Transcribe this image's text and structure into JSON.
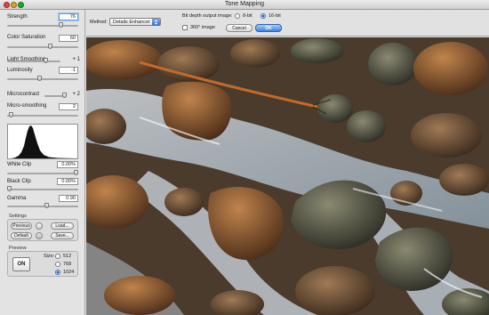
{
  "window": {
    "title": "Tone Mapping"
  },
  "sidebar": {
    "strength": {
      "label": "Strength",
      "value": "76",
      "level": 0.76
    },
    "color_saturation": {
      "label": "Color Saturation",
      "value": "60",
      "level": 0.6
    },
    "light_smoothing": {
      "label": "Light Smoothing",
      "value": "+ 1",
      "level": 0.72
    },
    "luminosity": {
      "label": "Luminosity",
      "value": "-1",
      "level": 0.45
    },
    "microcontrast": {
      "label": "Microcontrast",
      "value": "+ 2",
      "level": 1.0
    },
    "micro_smoothing": {
      "label": "Micro-smoothing",
      "value": "2",
      "level": 0.05
    },
    "white_clip": {
      "label": "White Clip",
      "value": "0.00%",
      "level": 1.0
    },
    "black_clip": {
      "label": "Black Clip",
      "value": "0.00%",
      "level": 0.0
    },
    "gamma": {
      "label": "Gamma",
      "value": "0.90",
      "level": 0.55
    },
    "settings": {
      "title": "Settings",
      "previous_label": "Previous",
      "load_label": "Load...",
      "default_label": "Default",
      "save_label": "Save..."
    },
    "preview": {
      "title": "Preview",
      "on_label": "ON",
      "size_label": "Size:",
      "sizes": [
        "512",
        "768",
        "1024"
      ],
      "selected_size": "1024"
    }
  },
  "toolbar": {
    "method_label": "Method:",
    "method_value": "Details Enhancer",
    "bit_depth_label": "Bit depth output image:",
    "bit_options": [
      "8-bit",
      "16-bit"
    ],
    "selected_bit": "16-bit",
    "image360_label": "360° image",
    "cancel_label": "Cancel",
    "ok_label": "OK"
  },
  "colors": {
    "accent": "#3b82e0",
    "panel": "#e3e3e3"
  }
}
